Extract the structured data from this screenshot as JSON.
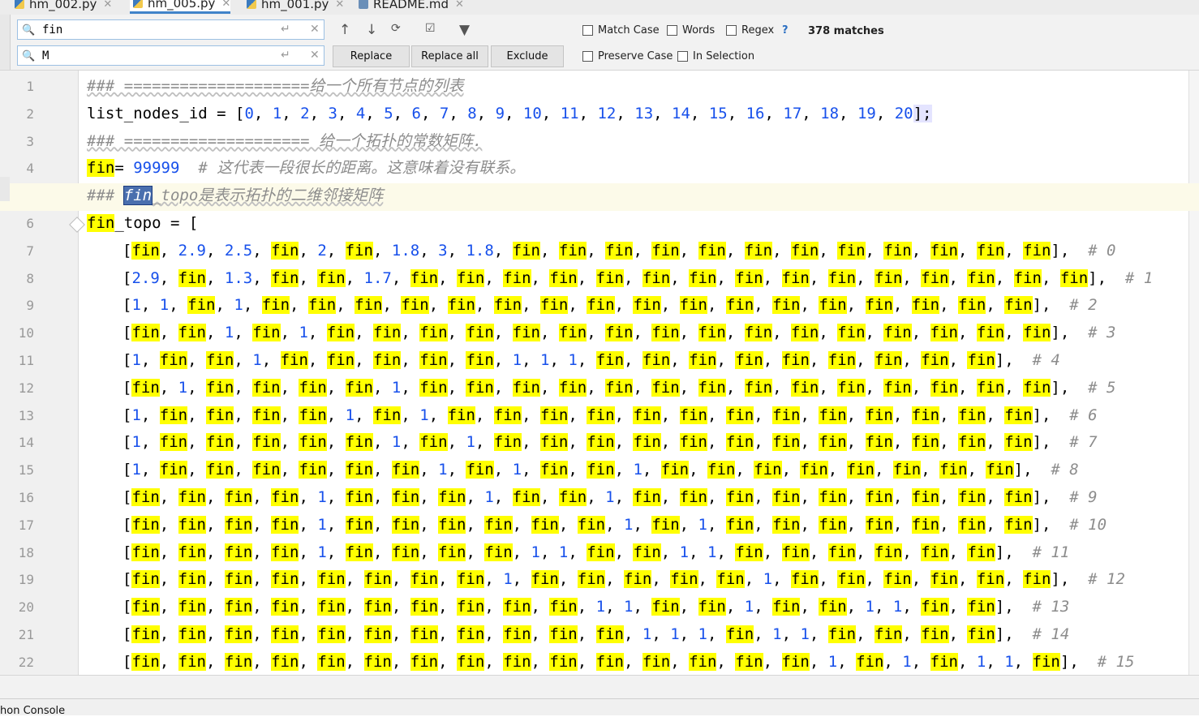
{
  "tabs": [
    {
      "label": "hm_002.py",
      "active": false
    },
    {
      "label": "hm_005.py",
      "active": true
    },
    {
      "label": "hm_001.py",
      "active": false
    },
    {
      "label": "README.md",
      "active": false
    }
  ],
  "find": {
    "search_value": "fin",
    "replace_value": "M",
    "replace_label": "Replace",
    "replace_all_label": "Replace all",
    "exclude_label": "Exclude",
    "match_case_label": "Match Case",
    "words_label": "Words",
    "regex_label": "Regex",
    "help_label": "?",
    "preserve_case_label": "Preserve Case",
    "in_selection_label": "In Selection",
    "match_count": "378 matches"
  },
  "colors": {
    "highlight": "#ffff00",
    "number": "#1750eb",
    "comment": "#8c8c8c"
  },
  "line_numbers": [
    "1",
    "2",
    "3",
    "4",
    "5",
    "6",
    "7",
    "8",
    "9",
    "10",
    "11",
    "12",
    "13",
    "14",
    "15",
    "16",
    "17",
    "18",
    "19",
    "20",
    "21",
    "22"
  ],
  "code": {
    "l1": "### ====================给一个所有节点的列表",
    "l2_prefix": "list_nodes_id = [",
    "l2_nums": [
      "0",
      "1",
      "2",
      "3",
      "4",
      "5",
      "6",
      "7",
      "8",
      "9",
      "10",
      "11",
      "12",
      "13",
      "14",
      "15",
      "16",
      "17",
      "18",
      "19",
      "20"
    ],
    "l2_suffix": "];",
    "l3": "### ==================== 给一个拓扑的常数矩阵.",
    "l4_fin": "fin",
    "l4_eq": "= ",
    "l4_val": "99999",
    "l4_comment": "# 这代表一段很长的距离。这意味着没有联系。",
    "l5_prefix": "### ",
    "l5_sel": "fin",
    "l5_rest": "_topo是表示拓扑的二维邻接矩阵",
    "l6_fin": "fin",
    "l6_rest": "_topo = [",
    "rows": [
      {
        "cells": [
          "fin",
          "2.9",
          "2.5",
          "fin",
          "2",
          "fin",
          "1.8",
          "3",
          "1.8",
          "fin",
          "fin",
          "fin",
          "fin",
          "fin",
          "fin",
          "fin",
          "fin",
          "fin",
          "fin",
          "fin",
          "fin"
        ],
        "comment": "# 0"
      },
      {
        "cells": [
          "2.9",
          "fin",
          "1.3",
          "fin",
          "fin",
          "1.7",
          "fin",
          "fin",
          "fin",
          "fin",
          "fin",
          "fin",
          "fin",
          "fin",
          "fin",
          "fin",
          "fin",
          "fin",
          "fin",
          "fin",
          "fin"
        ],
        "comment": "# 1"
      },
      {
        "cells": [
          "1",
          "1",
          "fin",
          "1",
          "fin",
          "fin",
          "fin",
          "fin",
          "fin",
          "fin",
          "fin",
          "fin",
          "fin",
          "fin",
          "fin",
          "fin",
          "fin",
          "fin",
          "fin",
          "fin",
          "fin"
        ],
        "comment": "# 2"
      },
      {
        "cells": [
          "fin",
          "fin",
          "1",
          "fin",
          "1",
          "fin",
          "fin",
          "fin",
          "fin",
          "fin",
          "fin",
          "fin",
          "fin",
          "fin",
          "fin",
          "fin",
          "fin",
          "fin",
          "fin",
          "fin",
          "fin"
        ],
        "comment": "# 3"
      },
      {
        "cells": [
          "1",
          "fin",
          "fin",
          "1",
          "fin",
          "fin",
          "fin",
          "fin",
          "fin",
          "1",
          "1",
          "1",
          "fin",
          "fin",
          "fin",
          "fin",
          "fin",
          "fin",
          "fin",
          "fin",
          "fin"
        ],
        "comment": "# 4"
      },
      {
        "cells": [
          "fin",
          "1",
          "fin",
          "fin",
          "fin",
          "fin",
          "1",
          "fin",
          "fin",
          "fin",
          "fin",
          "fin",
          "fin",
          "fin",
          "fin",
          "fin",
          "fin",
          "fin",
          "fin",
          "fin",
          "fin"
        ],
        "comment": "# 5"
      },
      {
        "cells": [
          "1",
          "fin",
          "fin",
          "fin",
          "fin",
          "1",
          "fin",
          "1",
          "fin",
          "fin",
          "fin",
          "fin",
          "fin",
          "fin",
          "fin",
          "fin",
          "fin",
          "fin",
          "fin",
          "fin",
          "fin"
        ],
        "comment": "# 6"
      },
      {
        "cells": [
          "1",
          "fin",
          "fin",
          "fin",
          "fin",
          "fin",
          "1",
          "fin",
          "1",
          "fin",
          "fin",
          "fin",
          "fin",
          "fin",
          "fin",
          "fin",
          "fin",
          "fin",
          "fin",
          "fin",
          "fin"
        ],
        "comment": "# 7"
      },
      {
        "cells": [
          "1",
          "fin",
          "fin",
          "fin",
          "fin",
          "fin",
          "fin",
          "1",
          "fin",
          "1",
          "fin",
          "fin",
          "1",
          "fin",
          "fin",
          "fin",
          "fin",
          "fin",
          "fin",
          "fin",
          "fin"
        ],
        "comment": "# 8"
      },
      {
        "cells": [
          "fin",
          "fin",
          "fin",
          "fin",
          "1",
          "fin",
          "fin",
          "fin",
          "1",
          "fin",
          "fin",
          "1",
          "fin",
          "fin",
          "fin",
          "fin",
          "fin",
          "fin",
          "fin",
          "fin",
          "fin"
        ],
        "comment": "# 9"
      },
      {
        "cells": [
          "fin",
          "fin",
          "fin",
          "fin",
          "1",
          "fin",
          "fin",
          "fin",
          "fin",
          "fin",
          "fin",
          "1",
          "fin",
          "1",
          "fin",
          "fin",
          "fin",
          "fin",
          "fin",
          "fin",
          "fin"
        ],
        "comment": "# 10"
      },
      {
        "cells": [
          "fin",
          "fin",
          "fin",
          "fin",
          "1",
          "fin",
          "fin",
          "fin",
          "fin",
          "1",
          "1",
          "fin",
          "fin",
          "1",
          "1",
          "fin",
          "fin",
          "fin",
          "fin",
          "fin",
          "fin"
        ],
        "comment": "# 11"
      },
      {
        "cells": [
          "fin",
          "fin",
          "fin",
          "fin",
          "fin",
          "fin",
          "fin",
          "fin",
          "1",
          "fin",
          "fin",
          "fin",
          "fin",
          "fin",
          "1",
          "fin",
          "fin",
          "fin",
          "fin",
          "fin",
          "fin"
        ],
        "comment": "# 12"
      },
      {
        "cells": [
          "fin",
          "fin",
          "fin",
          "fin",
          "fin",
          "fin",
          "fin",
          "fin",
          "fin",
          "fin",
          "1",
          "1",
          "fin",
          "fin",
          "1",
          "fin",
          "fin",
          "1",
          "1",
          "fin",
          "fin"
        ],
        "comment": "# 13"
      },
      {
        "cells": [
          "fin",
          "fin",
          "fin",
          "fin",
          "fin",
          "fin",
          "fin",
          "fin",
          "fin",
          "fin",
          "fin",
          "1",
          "1",
          "1",
          "fin",
          "1",
          "1",
          "fin",
          "fin",
          "fin",
          "fin"
        ],
        "comment": "# 14"
      },
      {
        "cells": [
          "fin",
          "fin",
          "fin",
          "fin",
          "fin",
          "fin",
          "fin",
          "fin",
          "fin",
          "fin",
          "fin",
          "fin",
          "fin",
          "fin",
          "fin",
          "1",
          "fin",
          "1",
          "fin",
          "1",
          "1",
          "fin"
        ],
        "comment": "# 15"
      }
    ]
  },
  "bottom": {
    "console_label": "hon Console"
  }
}
